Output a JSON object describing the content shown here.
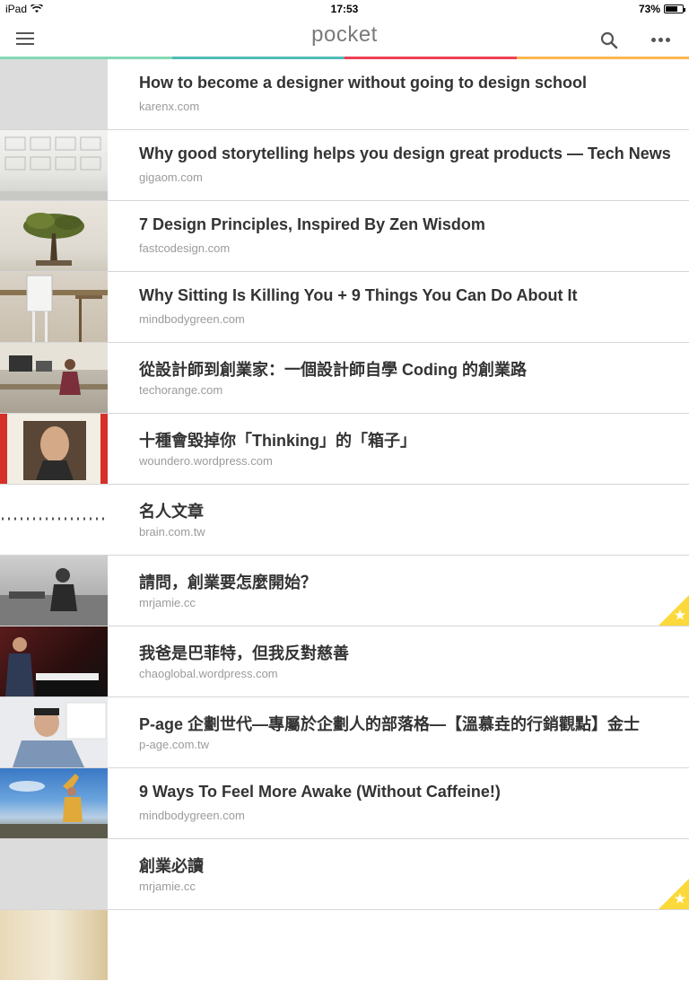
{
  "status": {
    "device": "iPad",
    "time": "17:53",
    "battery": "73%",
    "battery_level": 0.73
  },
  "nav": {
    "logo": "pocket",
    "icons": [
      "menu-icon",
      "search-icon",
      "more-icon"
    ]
  },
  "colors": {
    "bar": [
      "#83d9b5",
      "#50bcb6",
      "#ef4056",
      "#fcb64e"
    ],
    "favorite": "#fcd93a"
  },
  "items": [
    {
      "title": "How to become a designer without going to design school",
      "domain": "karenx.com",
      "favorite": false
    },
    {
      "title": "Why good storytelling helps you design great products — Tech News",
      "domain": "gigaom.com",
      "favorite": false
    },
    {
      "title": "7 Design Principles, Inspired By Zen Wisdom",
      "domain": "fastcodesign.com",
      "favorite": false
    },
    {
      "title": "Why Sitting Is Killing You + 9 Things You Can Do About It",
      "domain": "mindbodygreen.com",
      "favorite": false
    },
    {
      "title": "從設計師到創業家：一個設計師自學 Coding 的創業路",
      "domain": "techorange.com",
      "favorite": false
    },
    {
      "title": "十種會毀掉你「Thinking」的「箱子」",
      "domain": "woundero.wordpress.com",
      "favorite": false
    },
    {
      "title": "名人文章",
      "domain": "brain.com.tw",
      "favorite": false
    },
    {
      "title": "請問，創業要怎麼開始？",
      "domain": "mrjamie.cc",
      "favorite": true
    },
    {
      "title": "我爸是巴菲特，但我反對慈善",
      "domain": "chaoglobal.wordpress.com",
      "favorite": false
    },
    {
      "title": "P-age 企劃世代—專屬於企劃人的部落格—【溫慕垚的行銷觀點】金士",
      "domain": "p-age.com.tw",
      "favorite": false
    },
    {
      "title": "9 Ways To Feel More Awake (Without Caffeine!)",
      "domain": "mindbodygreen.com",
      "favorite": false
    },
    {
      "title": "創業必讀",
      "domain": "mrjamie.cc",
      "favorite": true
    }
  ]
}
